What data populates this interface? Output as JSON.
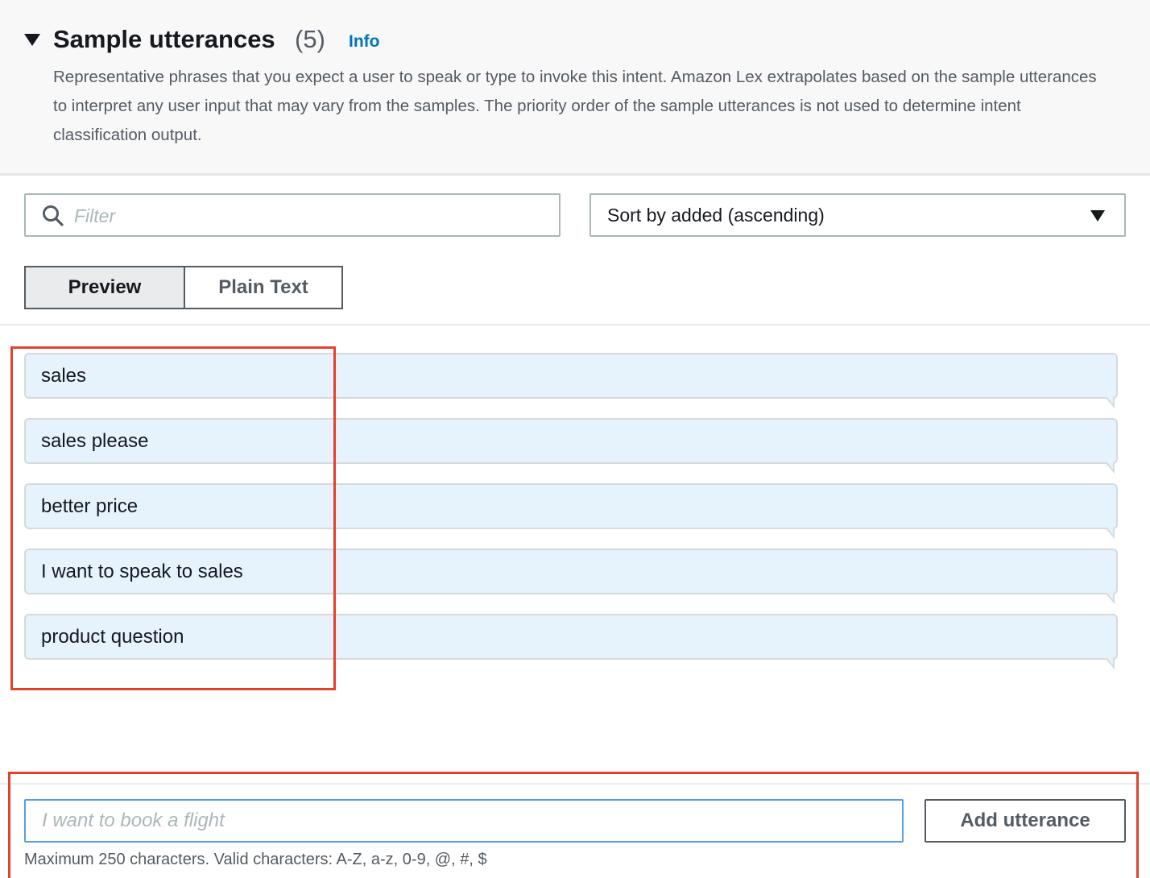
{
  "section": {
    "title": "Sample utterances",
    "count": "(5)",
    "info_label": "Info",
    "description": "Representative phrases that you expect a user to speak or type to invoke this intent. Amazon Lex extrapolates based on the sample utterances to interpret any user input that may vary from the samples. The priority order of the sample utterances is not used to determine intent classification output."
  },
  "filter": {
    "placeholder": "Filter",
    "value": ""
  },
  "sort": {
    "selected": "Sort by added (ascending)"
  },
  "view_toggle": {
    "options": [
      {
        "label": "Preview",
        "selected": true
      },
      {
        "label": "Plain Text",
        "selected": false
      }
    ]
  },
  "utterances": [
    {
      "text": "sales"
    },
    {
      "text": "sales please"
    },
    {
      "text": "better price"
    },
    {
      "text": "I want to speak to sales"
    },
    {
      "text": "product question"
    }
  ],
  "add_form": {
    "placeholder": "I want to book a flight",
    "value": "",
    "button_label": "Add utterance",
    "constraint_text": "Maximum 250 characters. Valid characters: A-Z, a-z, 0-9, @, #, $"
  },
  "colors": {
    "link": "#0073bb",
    "bubble_background": "#e6f2fc",
    "highlight_outline": "#e3412b",
    "focus_border": "#539fe5"
  },
  "icons": {
    "expand": "caret-down-icon",
    "search": "search-icon",
    "dropdown": "dropdown-arrow-icon"
  }
}
